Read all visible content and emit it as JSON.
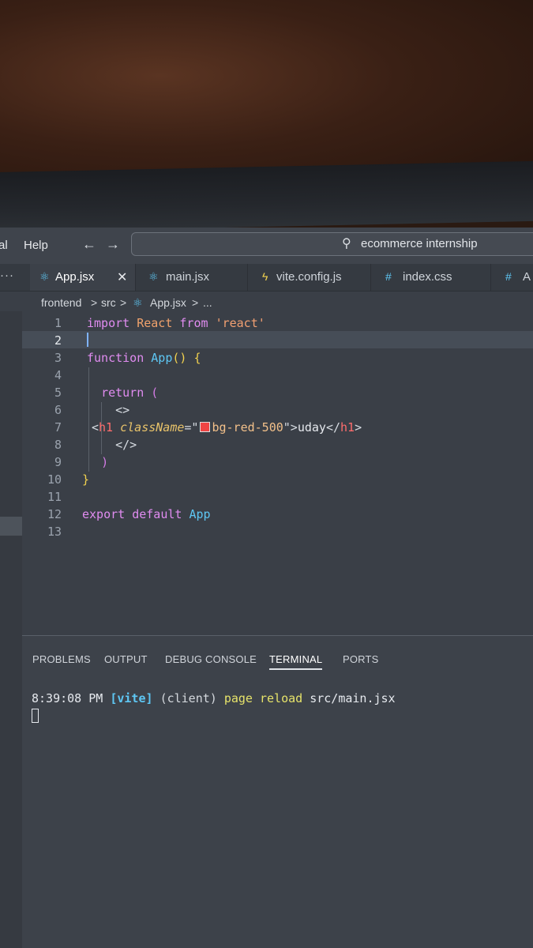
{
  "window": {
    "menu": [
      "al",
      "Help"
    ],
    "search_text": "ecommerce internship"
  },
  "tabs": [
    {
      "label": "App.jsx",
      "icon": "react-icon",
      "active": true,
      "close": "✕"
    },
    {
      "label": "main.jsx",
      "icon": "react-icon",
      "active": false
    },
    {
      "label": "vite.config.js",
      "icon": "bolt-icon",
      "active": false
    },
    {
      "label": "index.css",
      "icon": "hash-icon",
      "active": false
    },
    {
      "label": "A",
      "icon": "hash-icon",
      "active": false
    }
  ],
  "more_tabs": "···",
  "breadcrumb": [
    "frontend",
    ">",
    "src",
    ">",
    "App.jsx",
    ">",
    "..."
  ],
  "editor": {
    "current_line": 2,
    "lines": [
      {
        "n": "1",
        "parts": [
          [
            "kw",
            "import"
          ],
          [
            "txt",
            " "
          ],
          [
            "ident",
            "React"
          ],
          [
            "txt",
            " "
          ],
          [
            "kw",
            "from"
          ],
          [
            "txt",
            " "
          ],
          [
            "str",
            "'react'"
          ]
        ]
      },
      {
        "n": "2",
        "parts": []
      },
      {
        "n": "3",
        "parts": [
          [
            "kw",
            "function"
          ],
          [
            "txt",
            " "
          ],
          [
            "fn",
            "App"
          ],
          [
            "brace",
            "()"
          ],
          [
            "txt",
            " "
          ],
          [
            "brace",
            "{"
          ]
        ]
      },
      {
        "n": "4",
        "parts": []
      },
      {
        "n": "5",
        "parts": [
          [
            "txt",
            "  "
          ],
          [
            "kw",
            "return"
          ],
          [
            "txt",
            " "
          ],
          [
            "paren",
            "("
          ]
        ]
      },
      {
        "n": "6",
        "parts": [
          [
            "txt",
            "    "
          ],
          [
            "punct",
            "<>"
          ]
        ]
      },
      {
        "n": "7",
        "parts": [
          [
            "punct",
            "<"
          ],
          [
            "tag",
            "h1"
          ],
          [
            "txt",
            " "
          ],
          [
            "attr",
            "className"
          ],
          [
            "punct",
            "=\""
          ],
          [
            "swatch",
            ""
          ],
          [
            "strval",
            "bg-red-500"
          ],
          [
            "punct",
            "\">"
          ],
          [
            "txt",
            "uday"
          ],
          [
            "punct",
            "</"
          ],
          [
            "tag",
            "h1"
          ],
          [
            "punct",
            ">"
          ]
        ]
      },
      {
        "n": "8",
        "parts": [
          [
            "txt",
            "    "
          ],
          [
            "punct",
            "</>"
          ]
        ]
      },
      {
        "n": "9",
        "parts": [
          [
            "txt",
            "  "
          ],
          [
            "paren",
            ")"
          ]
        ]
      },
      {
        "n": "10",
        "parts": [
          [
            "brace",
            "}"
          ]
        ]
      },
      {
        "n": "11",
        "parts": []
      },
      {
        "n": "12",
        "parts": [
          [
            "kw",
            "export"
          ],
          [
            "txt",
            " "
          ],
          [
            "kw",
            "default"
          ],
          [
            "txt",
            " "
          ],
          [
            "fn",
            "App"
          ]
        ]
      },
      {
        "n": "13",
        "parts": []
      }
    ]
  },
  "panel": {
    "tabs": [
      "PROBLEMS",
      "OUTPUT",
      "DEBUG CONSOLE",
      "TERMINAL",
      "PORTS"
    ],
    "active_tab": "TERMINAL",
    "terminal": {
      "time": "8:39:08 PM",
      "tag": "[vite]",
      "source": "(client)",
      "action": "page reload",
      "file": "src/main.jsx"
    }
  },
  "colors": {
    "editor_bg": "#3a3f47",
    "keyword": "#e08cf0",
    "string": "#f2a072",
    "function": "#5ec7f4",
    "swatch": "#ef4444"
  }
}
